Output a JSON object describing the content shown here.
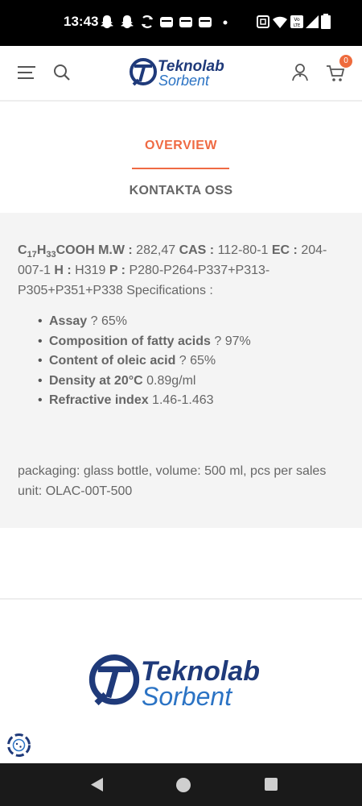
{
  "status_bar": {
    "time": "13:43"
  },
  "header": {
    "logo_line1": "Teknolab",
    "logo_line2": "Sorbent",
    "cart_count": "0"
  },
  "tabs": {
    "overview": "OVERVIEW",
    "contact": "KONTAKTA OSS"
  },
  "spec": {
    "formula_c": "C",
    "formula_c_sub": "17",
    "formula_h": "H",
    "formula_h_sub": "33",
    "formula_rest": "COOH",
    "mw_label": "M.W :",
    "mw_value": " 282,47 ",
    "cas_label": "CAS :",
    "cas_value": " 112-80-1 ",
    "ec_label": "EC :",
    "ec_value": " 204-007-1 ",
    "h_label": "H :",
    "h_value": " H319 ",
    "p_label": "P :",
    "p_value": " P280-P264-P337+P313-P305+P351+P338 Specifications :"
  },
  "bullets": [
    {
      "label": "Assay",
      "value": " ? 65%"
    },
    {
      "label": "Composition of fatty acids",
      "value": " ? 97%"
    },
    {
      "label": "Content of oleic acid",
      "value": " ? 65%"
    },
    {
      "label": "Density at 20°C",
      "value": " 0.89g/ml"
    },
    {
      "label": "Refractive index",
      "value": " 1.46-1.463"
    }
  ],
  "packaging": "packaging: glass bottle, volume: 500 ml, pcs per sales unit: OLAC-00T-500",
  "footer": {
    "logo_line1": "Teknolab",
    "logo_line2": "Sorbent"
  },
  "colors": {
    "accent": "#ef6a43",
    "logo_dark": "#1f3a7a",
    "logo_light": "#2b73c4"
  }
}
